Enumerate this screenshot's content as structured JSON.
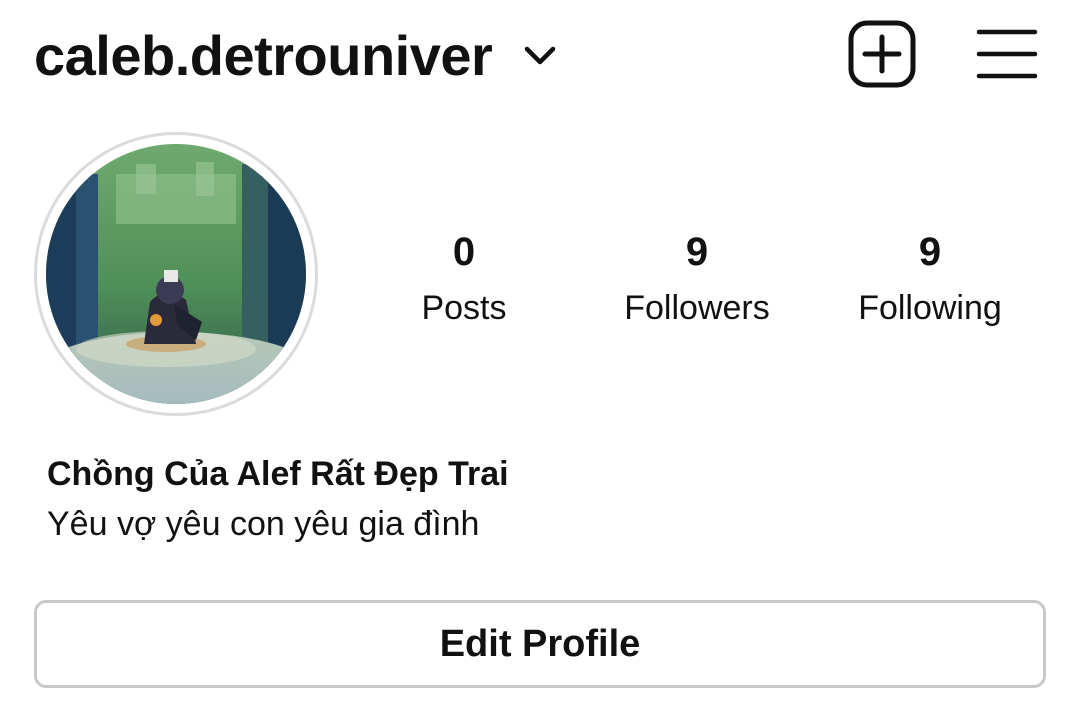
{
  "header": {
    "username": "caleb.detrouniver",
    "account_switcher_icon": "chevron-down-icon",
    "new_post_icon": "plus-square-icon",
    "menu_icon": "hamburger-menu-icon"
  },
  "profile": {
    "avatar_description_icon": "profile-avatar",
    "stats": {
      "posts": {
        "count": "0",
        "label": "Posts"
      },
      "followers": {
        "count": "9",
        "label": "Followers"
      },
      "following": {
        "count": "9",
        "label": "Following"
      }
    },
    "display_name": "Chồng Của Alef Rất Đẹp Trai",
    "bio": "Yêu vợ yêu con yêu gia đình"
  },
  "actions": {
    "edit_profile_label": "Edit Profile"
  },
  "colors": {
    "text": "#111111",
    "border": "#c8c8c8",
    "avatar_ring": "#dbdbdb",
    "background": "#ffffff"
  }
}
